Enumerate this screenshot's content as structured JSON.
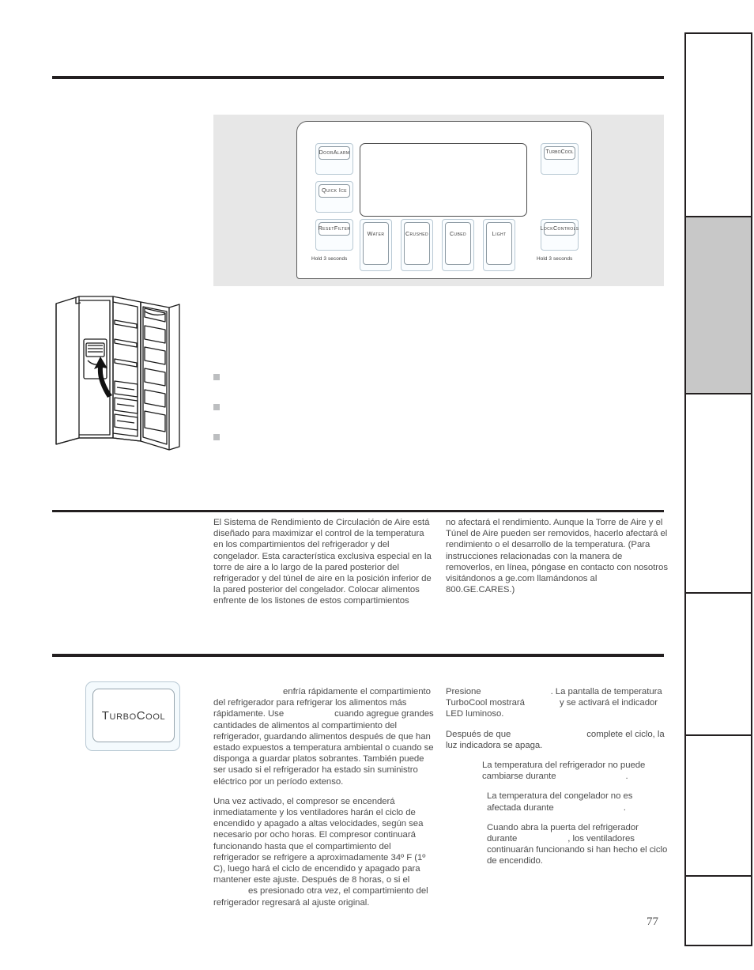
{
  "page": {
    "number": "77"
  },
  "control_panel": {
    "caption_hold_reset": "Hold  3 seconds",
    "caption_hold_lock": "Hold  3 seconds",
    "keys": [
      {
        "id": "door-alarm",
        "label": "Door\nAlarm"
      },
      {
        "id": "quick-ice",
        "label": "Quick Ice"
      },
      {
        "id": "reset-filter",
        "label": "Reset\nFilter"
      },
      {
        "id": "turbocool",
        "label": "TurboCool"
      },
      {
        "id": "lock-controls",
        "label": "Lock\nControls"
      },
      {
        "id": "water",
        "label": "Water"
      },
      {
        "id": "crushed",
        "label": "Crushed"
      },
      {
        "id": "cubed",
        "label": "Cubed"
      },
      {
        "id": "light",
        "label": "Light"
      }
    ],
    "key_labels": {
      "door_alarm_line1": "Door",
      "door_alarm_line2": "Alarm",
      "quick_ice": "Quick Ice",
      "reset_filter_line1": "Reset",
      "reset_filter_line2": "Filter",
      "turbocool": "TurboCool",
      "lock_line1": "Lock",
      "lock_line2": "Controls",
      "water": "Water",
      "crushed": "Crushed",
      "cubed": "Cubed",
      "light": "Light"
    }
  },
  "bullets": [
    {
      "text": ""
    },
    {
      "text": ""
    },
    {
      "text": ""
    }
  ],
  "airflow_section": {
    "left_column": "El Sistema de Rendimiento de Circulación de Aire está diseñado para maximizar el control de la temperatura en los compartimientos del refrigerador y del congelador. Esta característica exclusiva especial en la torre de aire a lo largo de la pared posterior del refrigerador y del túnel de aire en la posición inferior de la pared posterior del congelador. Colocar alimentos enfrente de los listones de estos compartimientos",
    "right_column": "no afectará el rendimiento. Aunque la Torre de Aire y el Túnel de Aire pueden ser removidos, hacerlo afectará el rendimiento o el desarrollo de la temperatura. (Para instrucciones relacionadas con la manera de removerlos, en línea, póngase en contacto con nosotros visitándonos a ge.com llamándonos al 800.GE.CARES.)"
  },
  "turbocool_section": {
    "button_label": "TurboCool",
    "left_paragraph_1_a": "enfría rápidamente el compartimiento del refrigerador para refrigerar los alimentos más rápidamente. Use",
    "left_paragraph_1_b": "cuando agregue grandes cantidades de alimentos al compartimiento del refrigerador, guardando alimentos después de que han estado expuestos a temperatura ambiental o cuando se disponga a guardar platos sobrantes. También puede ser usado si el refrigerador ha estado sin suministro eléctrico por un período extenso.",
    "left_paragraph_2_a": "Una vez activado, el compresor se encenderá inmediatamente y los ventiladores harán el ciclo de encendido y apagado a altas velocidades, según sea necesario por ocho horas. El compresor continuará funcionando hasta que el compartimiento del refrigerador se refrigere a aproximadamente 34º F (1º C), luego hará el ciclo de encendido y apagado para mantener este ajuste. Después de 8 horas, o si el",
    "left_paragraph_2_b": "es presionado otra vez, el compartimiento del refrigerador regresará al ajuste original.",
    "right_paragraph_1_a": "Presione",
    "right_paragraph_1_b": ". La pantalla de temperatura TurboCool mostrará",
    "right_paragraph_1_c": "y se activará el indicador LED luminoso.",
    "right_paragraph_2_a": "Después de que",
    "right_paragraph_2_b": "complete el ciclo, la luz indicadora se apaga.",
    "note_1_a": "La temperatura del refrigerador no puede cambiarse durante",
    "note_1_b": ".",
    "note_2_a": "La temperatura del congelador no es afectada durante",
    "note_2_b": ".",
    "note_3_a": "Cuando abra la puerta del refrigerador durante",
    "note_3_b": ", los ventiladores continuarán funcionando si han hecho el ciclo de encendido."
  },
  "tab_strip": {
    "segments": [
      {
        "id": "segment-1",
        "active": false
      },
      {
        "id": "segment-2",
        "active": true
      },
      {
        "id": "segment-3",
        "active": false
      },
      {
        "id": "segment-4",
        "active": false
      },
      {
        "id": "segment-5",
        "active": false
      },
      {
        "id": "segment-6",
        "active": false
      }
    ]
  },
  "colors": {
    "rule": "#231f20",
    "panel_background": "#e7e7e7",
    "key_face": "#fafdff",
    "key_border": "#b9c9d4",
    "tab_active": "#c8c8c8",
    "bullet": "#bcbec0",
    "body_text": "#4d4d4d"
  }
}
